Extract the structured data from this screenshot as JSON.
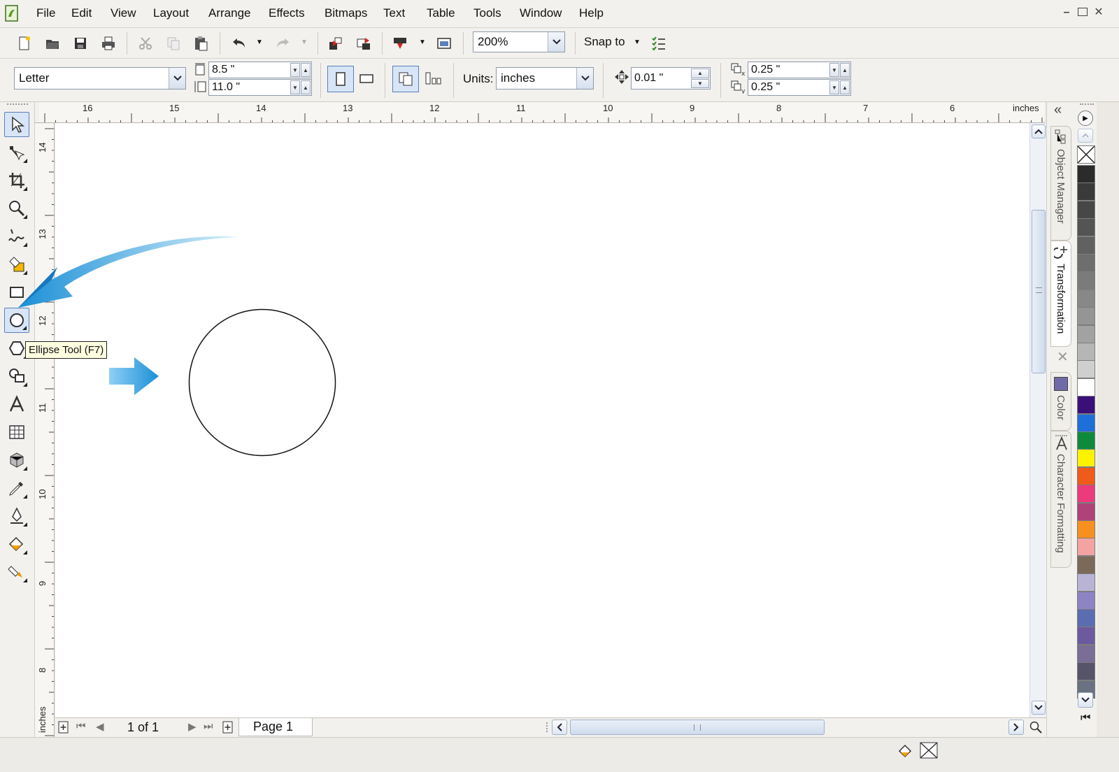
{
  "menubar": {
    "items": [
      "File",
      "Edit",
      "View",
      "Layout",
      "Arrange",
      "Effects",
      "Bitmaps",
      "Text",
      "Table",
      "Tools",
      "Window",
      "Help"
    ]
  },
  "toolbar": {
    "zoom": "200%",
    "snap_to": "Snap to"
  },
  "property_bar": {
    "paper_size": "Letter",
    "width": "8.5 \"",
    "height": "11.0 \"",
    "units_label": "Units:",
    "units_value": "inches",
    "nudge": "0.01 \"",
    "dup_x": "0.25 \"",
    "dup_y": "0.25 \""
  },
  "ruler": {
    "unit": "inches",
    "h_labels": [
      "16",
      "15",
      "14",
      "13",
      "12",
      "11",
      "10",
      "9",
      "8",
      "7",
      "6"
    ],
    "v_labels": [
      "14",
      "13",
      "12",
      "11",
      "10",
      "9",
      "8"
    ]
  },
  "tooltip": {
    "text": "Ellipse Tool (F7)"
  },
  "page_nav": {
    "page_count": "1 of 1",
    "page_tab": "Page 1"
  },
  "dockers": {
    "object_manager": "Object Manager",
    "transformation": "Transformation",
    "color": "Color",
    "character_formatting": "Character Formatting"
  },
  "palette": {
    "colors": [
      "#2b2b2b",
      "#3a3a3a",
      "#474747",
      "#545454",
      "#616161",
      "#6e6e6e",
      "#7b7b7b",
      "#888888",
      "#959595",
      "#a2a2a2",
      "#b6b6b6",
      "#cfcfcf",
      "#ffffff",
      "#3a1078",
      "#1e6fd9",
      "#0f8a3c",
      "#fff200",
      "#f05a1a",
      "#ec3a7c",
      "#b0427a",
      "#f7901e",
      "#f4a3a3",
      "#7b6a5a",
      "#b9b3d6",
      "#8d84c4",
      "#5b6db0",
      "#6d5a9e",
      "#7a6e96",
      "#565468",
      "#6a7281"
    ]
  }
}
